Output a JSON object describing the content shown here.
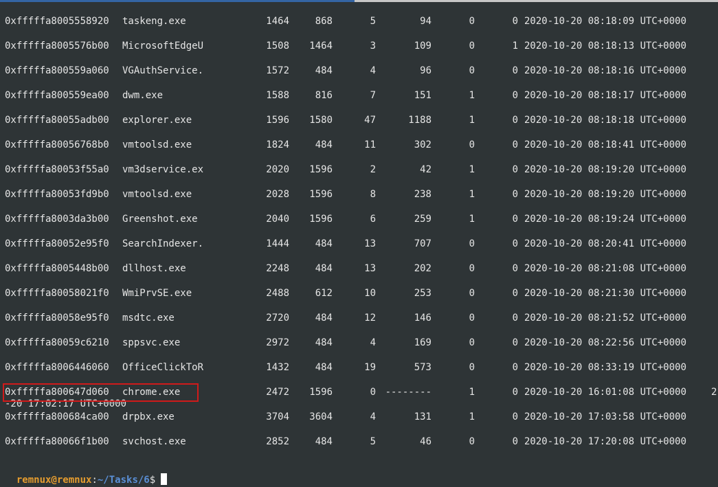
{
  "terminal": {
    "rows": [
      {
        "offset": "0xfffffa8005558920",
        "name": "taskeng.exe",
        "pid": "1464",
        "ppid": "868",
        "thds": "5",
        "hnds": "94",
        "sess": "0",
        "wow64": "0",
        "start": "2020-10-20 08:18:09 UTC+0000"
      },
      {
        "offset": "0xfffffa8005576b00",
        "name": "MicrosoftEdgeU",
        "pid": "1508",
        "ppid": "1464",
        "thds": "3",
        "hnds": "109",
        "sess": "0",
        "wow64": "1",
        "start": "2020-10-20 08:18:13 UTC+0000"
      },
      {
        "offset": "0xfffffa800559a060",
        "name": "VGAuthService.",
        "pid": "1572",
        "ppid": "484",
        "thds": "4",
        "hnds": "96",
        "sess": "0",
        "wow64": "0",
        "start": "2020-10-20 08:18:16 UTC+0000"
      },
      {
        "offset": "0xfffffa800559ea00",
        "name": "dwm.exe",
        "pid": "1588",
        "ppid": "816",
        "thds": "7",
        "hnds": "151",
        "sess": "1",
        "wow64": "0",
        "start": "2020-10-20 08:18:17 UTC+0000"
      },
      {
        "offset": "0xfffffa80055adb00",
        "name": "explorer.exe",
        "pid": "1596",
        "ppid": "1580",
        "thds": "47",
        "hnds": "1188",
        "sess": "1",
        "wow64": "0",
        "start": "2020-10-20 08:18:18 UTC+0000"
      },
      {
        "offset": "0xfffffa80056768b0",
        "name": "vmtoolsd.exe",
        "pid": "1824",
        "ppid": "484",
        "thds": "11",
        "hnds": "302",
        "sess": "0",
        "wow64": "0",
        "start": "2020-10-20 08:18:41 UTC+0000"
      },
      {
        "offset": "0xfffffa80053f55a0",
        "name": "vm3dservice.ex",
        "pid": "2020",
        "ppid": "1596",
        "thds": "2",
        "hnds": "42",
        "sess": "1",
        "wow64": "0",
        "start": "2020-10-20 08:19:20 UTC+0000"
      },
      {
        "offset": "0xfffffa80053fd9b0",
        "name": "vmtoolsd.exe",
        "pid": "2028",
        "ppid": "1596",
        "thds": "8",
        "hnds": "238",
        "sess": "1",
        "wow64": "0",
        "start": "2020-10-20 08:19:20 UTC+0000"
      },
      {
        "offset": "0xfffffa8003da3b00",
        "name": "Greenshot.exe",
        "pid": "2040",
        "ppid": "1596",
        "thds": "6",
        "hnds": "259",
        "sess": "1",
        "wow64": "0",
        "start": "2020-10-20 08:19:24 UTC+0000"
      },
      {
        "offset": "0xfffffa80052e95f0",
        "name": "SearchIndexer.",
        "pid": "1444",
        "ppid": "484",
        "thds": "13",
        "hnds": "707",
        "sess": "0",
        "wow64": "0",
        "start": "2020-10-20 08:20:41 UTC+0000"
      },
      {
        "offset": "0xfffffa8005448b00",
        "name": "dllhost.exe",
        "pid": "2248",
        "ppid": "484",
        "thds": "13",
        "hnds": "202",
        "sess": "0",
        "wow64": "0",
        "start": "2020-10-20 08:21:08 UTC+0000"
      },
      {
        "offset": "0xfffffa80058021f0",
        "name": "WmiPrvSE.exe",
        "pid": "2488",
        "ppid": "612",
        "thds": "10",
        "hnds": "253",
        "sess": "0",
        "wow64": "0",
        "start": "2020-10-20 08:21:30 UTC+0000"
      },
      {
        "offset": "0xfffffa80058e95f0",
        "name": "msdtc.exe",
        "pid": "2720",
        "ppid": "484",
        "thds": "12",
        "hnds": "146",
        "sess": "0",
        "wow64": "0",
        "start": "2020-10-20 08:21:52 UTC+0000"
      },
      {
        "offset": "0xfffffa80059c6210",
        "name": "sppsvc.exe",
        "pid": "2972",
        "ppid": "484",
        "thds": "4",
        "hnds": "169",
        "sess": "0",
        "wow64": "0",
        "start": "2020-10-20 08:22:56 UTC+0000"
      },
      {
        "offset": "0xfffffa8006446060",
        "name": "OfficeClickToR",
        "pid": "1432",
        "ppid": "484",
        "thds": "19",
        "hnds": "573",
        "sess": "0",
        "wow64": "0",
        "start": "2020-10-20 08:33:19 UTC+0000"
      },
      {
        "offset": "0xfffffa800647d060",
        "name": "chrome.exe",
        "pid": "2472",
        "ppid": "1596",
        "thds": "0",
        "hnds": "--------",
        "sess": "1",
        "wow64": "0",
        "start": "2020-10-20 16:01:08 UTC+0000",
        "exit": "2"
      },
      {
        "offset": "0xfffffa800684ca00",
        "name": "drpbx.exe",
        "pid": "3704",
        "ppid": "3604",
        "thds": "4",
        "hnds": "131",
        "sess": "1",
        "wow64": "0",
        "start": "2020-10-20 17:03:58 UTC+0000"
      },
      {
        "offset": "0xfffffa80066f1b00",
        "name": "svchost.exe",
        "pid": "2852",
        "ppid": "484",
        "thds": "5",
        "hnds": "46",
        "sess": "0",
        "wow64": "0",
        "start": "2020-10-20 17:20:08 UTC+0000"
      }
    ],
    "wrapped_exit_text": "-20 17:02:17 UTC+0000",
    "prompt": {
      "user_host": "remnux@remnux",
      "colon": ":",
      "path": "~/Tasks/6",
      "dollar": "$"
    },
    "colors": {
      "background": "#2e3436",
      "text": "#e6e6e6",
      "prompt_user": "#e59c2f",
      "prompt_path": "#5a8fd6",
      "highlight_box": "#d11a1a",
      "tab_accent": "#3465a4"
    }
  }
}
